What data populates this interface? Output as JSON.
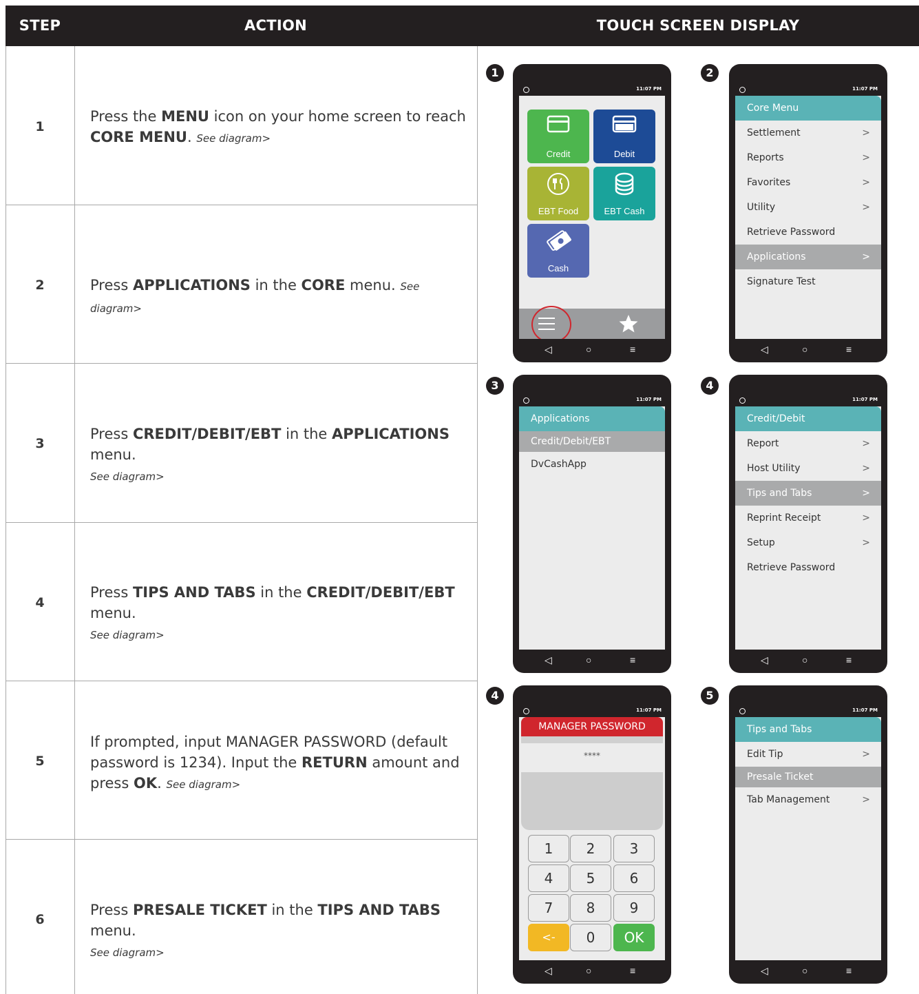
{
  "headers": {
    "step": "STEP",
    "action": "ACTION",
    "display": "TOUCH SCREEN DISPLAY"
  },
  "steps": [
    {
      "num": "1",
      "see": "See diagram>"
    },
    {
      "num": "2",
      "see": "See diagram>"
    },
    {
      "num": "3",
      "see": "See diagram>"
    },
    {
      "num": "4",
      "see": "See diagram>"
    },
    {
      "num": "5",
      "see": "See diagram>"
    },
    {
      "num": "6",
      "see": "See diagram>"
    }
  ],
  "step_text": {
    "s1_a": "Press the ",
    "s1_b": "MENU",
    "s1_c": " icon on your home screen to reach ",
    "s1_d": "CORE MENU",
    "s1_e": ". ",
    "s2_a": "Press ",
    "s2_b": "APPLICATIONS",
    "s2_c": " in the ",
    "s2_d": "CORE",
    "s2_e": " menu. ",
    "s3_a": "Press ",
    "s3_b": "CREDIT/DEBIT/EBT",
    "s3_c": " in the ",
    "s3_d": "APPLICATIONS",
    "s3_e": " menu.",
    "s4_a": "Press ",
    "s4_b": "TIPS AND TABS",
    "s4_c": " in the ",
    "s4_d": "CREDIT/DEBIT/EBT",
    "s4_e": " menu.",
    "s5_a": "If prompted, input MANAGER PASSWORD (default password is 1234). Input the ",
    "s5_b": "RETURN",
    "s5_c": " amount and press ",
    "s5_d": "OK",
    "s5_e": ". ",
    "s6_a": "Press ",
    "s6_b": "PRESALE TICKET",
    "s6_c": " in the ",
    "s6_d": "TIPS AND TABS",
    "s6_e": " menu."
  },
  "status_time": "11:07 PM",
  "nav_icons": [
    "back-icon",
    "home-icon",
    "menu-icon"
  ],
  "badges": [
    "1",
    "2",
    "3",
    "4",
    "4",
    "5"
  ],
  "home_screen": {
    "tiles": [
      {
        "label": "Credit",
        "color": "#4db64e"
      },
      {
        "label": "Debit",
        "color": "#1d4b96"
      },
      {
        "label": "EBT Food",
        "color": "#a8b435"
      },
      {
        "label": "EBT Cash",
        "color": "#1aa39b"
      },
      {
        "label": "Cash",
        "color": "#5568b1"
      }
    ],
    "debit_card_text": "DEBIT",
    "highlight_color": "#d0262d"
  },
  "core_menu": {
    "title": "Core Menu",
    "items": [
      {
        "label": "Settlement",
        "chev": ">"
      },
      {
        "label": "Reports",
        "chev": ">"
      },
      {
        "label": "Favorites",
        "chev": ">"
      },
      {
        "label": "Utility",
        "chev": ">"
      },
      {
        "label": "Retrieve Password",
        "chev": ""
      },
      {
        "label": "Applications",
        "chev": ">",
        "selected": true
      },
      {
        "label": "Signature Test",
        "chev": ""
      }
    ]
  },
  "applications_menu": {
    "title": "Applications",
    "items": [
      {
        "label": "Credit/Debit/EBT",
        "selected": true
      },
      {
        "label": "DvCashApp"
      }
    ]
  },
  "credit_debit_menu": {
    "title": "Credit/Debit",
    "items": [
      {
        "label": "Report",
        "chev": ">"
      },
      {
        "label": "Host Utility",
        "chev": ">"
      },
      {
        "label": "Tips and Tabs",
        "chev": ">",
        "selected": true
      },
      {
        "label": "Reprint Receipt",
        "chev": ">"
      },
      {
        "label": "Setup",
        "chev": ">"
      },
      {
        "label": "Retrieve Password",
        "chev": ""
      }
    ]
  },
  "password_screen": {
    "title": "MANAGER PASSWORD",
    "masked": "****",
    "keys": [
      "1",
      "2",
      "3",
      "4",
      "5",
      "6",
      "7",
      "8",
      "9",
      "<-",
      "0",
      "OK"
    ]
  },
  "tips_menu": {
    "title": "Tips and Tabs",
    "items": [
      {
        "label": "Edit Tip",
        "chev": ">"
      },
      {
        "label": "Presale Ticket",
        "chev": "",
        "selected": true
      },
      {
        "label": "Tab Management",
        "chev": ">"
      }
    ]
  }
}
